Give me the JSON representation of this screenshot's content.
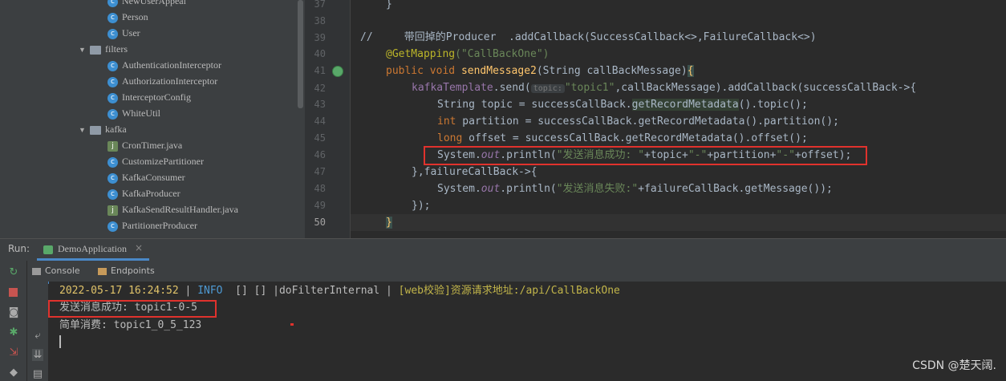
{
  "tree": {
    "items": [
      {
        "label": "NewUserAppeal",
        "type": "class"
      },
      {
        "label": "Person",
        "type": "class"
      },
      {
        "label": "User",
        "type": "class"
      },
      {
        "label": "filters",
        "type": "folder"
      },
      {
        "label": "AuthenticationInterceptor",
        "type": "class"
      },
      {
        "label": "AuthorizationInterceptor",
        "type": "class"
      },
      {
        "label": "InterceptorConfig",
        "type": "class"
      },
      {
        "label": "WhiteUtil",
        "type": "class"
      },
      {
        "label": "kafka",
        "type": "folder"
      },
      {
        "label": "CronTimer.java",
        "type": "file"
      },
      {
        "label": "CustomizePartitioner",
        "type": "class"
      },
      {
        "label": "KafkaConsumer",
        "type": "class"
      },
      {
        "label": "KafkaProducer",
        "type": "class"
      },
      {
        "label": "KafkaSendResultHandler.java",
        "type": "file"
      },
      {
        "label": "PartitionerProducer",
        "type": "class"
      }
    ]
  },
  "editor": {
    "line_numbers": [
      "37",
      "38",
      "39",
      "40",
      "41",
      "42",
      "43",
      "44",
      "45",
      "46",
      "47",
      "48",
      "49",
      "50"
    ],
    "current_line": "50",
    "comment_line": "//     带回掉的Producer  .addCallback(SuccessCallback<>,FailureCallback<>)",
    "annotation": "@GetMapping",
    "annotation_arg": "(\"CallBackOne\")",
    "kw_public": "public",
    "kw_void": "void",
    "method_name": "sendMessage2",
    "method_params": "(String callBackMessage)",
    "open_brace": "{",
    "field_kafka": "kafkaTemplate",
    "send_call": ".send(",
    "param_hint": "topic:",
    "topic_literal": "\"topic1\"",
    "send_rest": ",callBackMessage).addCallback(successCallBack->{",
    "l43": "String topic = successCallBack.",
    "l43_hl": "getRecordMetadata",
    "l43_end": "().topic();",
    "kw_int": "int",
    "l44": " partition = successCallBack.getRecordMetadata().partition();",
    "kw_long": "long",
    "l45": " offset = successCallBack.getRecordMetadata().offset();",
    "sys": "System.",
    "out": "out",
    "println": ".println(",
    "success_str": "\"发送消息成功: \"",
    "plus_topic": "+topic+",
    "dash1": "\"-\"",
    "plus_partition": "+partition+",
    "dash2": "\"-\"",
    "plus_offset": "+offset);",
    "failure_line": "},failureCallBack->{",
    "fail_str": "\"发送消息失败:\"",
    "fail_rest": "+failureCallBack.getMessage());",
    "close_callback": "});",
    "close_brace": "}",
    "line37": "}"
  },
  "run": {
    "label": "Run:",
    "tab_title": "DemoApplication",
    "close": "×",
    "console_tab": "Console",
    "endpoints_tab": "Endpoints"
  },
  "console": {
    "timestamp": "2022-05-17 16:24:52",
    "sep1": " | ",
    "level": "INFO",
    "mid": "  [] [] |doFilterInternal | ",
    "web": "[web校验]资源请求地址:/api/CallBackOne",
    "line2": "发送消息成功: topic1-0-5",
    "line3": "简单消费: topic1_0_5_123"
  },
  "watermark": "CSDN @楚天阔.",
  "colors": {
    "accent": "#4a88c7",
    "highlight_box": "#e0322d"
  }
}
